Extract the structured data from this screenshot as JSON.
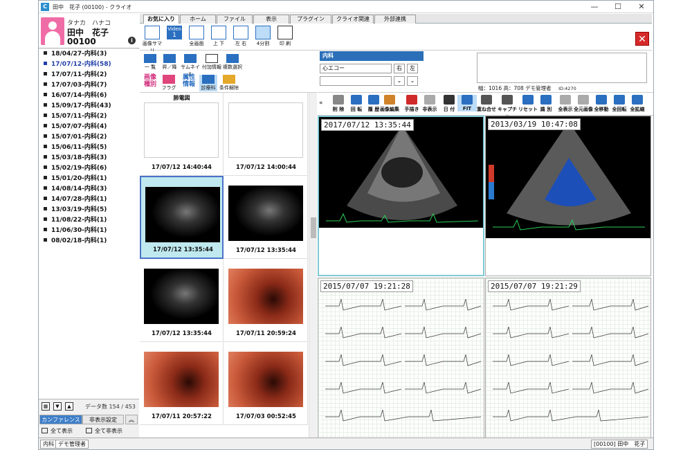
{
  "window": {
    "title": "田中　花子 (00100) - クライオ",
    "min": "—",
    "max": "☐",
    "close": "✕"
  },
  "patient": {
    "kana": "タナカ　ハナコ",
    "name": "田中　花子",
    "id": "00100"
  },
  "history": [
    "18/04/27-内科(3)",
    "17/07/12-内科(58)",
    "17/07/11-内科(2)",
    "17/07/03-内科(7)",
    "16/07/14-内科(6)",
    "15/09/17-内科(43)",
    "15/07/11-内科(2)",
    "15/07/07-内科(4)",
    "15/07/01-内科(2)",
    "15/06/11-内科(5)",
    "15/03/18-内科(3)",
    "15/02/19-内科(6)",
    "15/01/20-内科(1)",
    "14/08/14-内科(3)",
    "14/07/28-内科(1)",
    "13/03/19-内科(5)",
    "11/08/22-内科(1)",
    "11/06/30-内科(1)",
    "08/02/18-内科(1)"
  ],
  "leftfoot": {
    "count": "データ数 154 / 453",
    "tab1": "カンファレンス",
    "tab2": "非表示設定",
    "showall": "全て表示",
    "hideall": "全て非表示"
  },
  "ribbon_tabs": [
    "お気に入り",
    "ホーム",
    "ファイル",
    "表示",
    "プラグイン",
    "クライオ関連",
    "外部連携"
  ],
  "ribbon": {
    "summary": "画像サマリ",
    "video": "Video",
    "video_num": "1",
    "full": "全画面",
    "ud": "上 下",
    "lr": "左 右",
    "four": "4分割",
    "print": "印 刷"
  },
  "thumbtools": {
    "list": "一 覧",
    "updown": "昇／降",
    "thumb": "サムネイル",
    "attach": "付加情報",
    "multi": "複数選択",
    "type": "画像種別",
    "flag": "フラグ",
    "prop": "属性情報",
    "dept": "診療科",
    "cond": "条件解除"
  },
  "thumbs": [
    {
      "label": "肺電図",
      "caption": "17/07/12 14:40:44"
    },
    {
      "label": "",
      "caption": "17/07/12 14:00:44"
    },
    {
      "label": "",
      "caption": "17/07/12 13:35:44"
    },
    {
      "label": "",
      "caption": "17/07/12 13:35:44"
    },
    {
      "label": "",
      "caption": "17/07/12 13:35:44"
    },
    {
      "label": "",
      "caption": "17/07/11 20:59:24"
    },
    {
      "label": "",
      "caption": "17/07/11 20:57:22"
    },
    {
      "label": "",
      "caption": "17/07/03 00:52:45"
    }
  ],
  "viewer": {
    "dept": "内科",
    "select1": "心エコー",
    "right": "右",
    "left": "左",
    "dims": "幅：1016 高：708  デモ管理者",
    "id": "ID:4270"
  },
  "vtools": [
    "削 除",
    "回 転",
    "履 歴",
    "画像編集",
    "手描き",
    "非表示",
    "日 付",
    "FIT",
    "重ね合せ",
    "キャプチャ",
    "リセット",
    "識 別",
    "全表示",
    "全元画像",
    "全移動",
    "全回転",
    "全拡縮"
  ],
  "panes": [
    "2017/07/12 13:35:44",
    "2013/03/19 10:47:08",
    "2015/07/07 19:21:28",
    "2015/07/07 19:21:29"
  ],
  "status": {
    "dept": "内科",
    "user": "デモ管理者",
    "patient": "[00100] 田中　花子"
  }
}
